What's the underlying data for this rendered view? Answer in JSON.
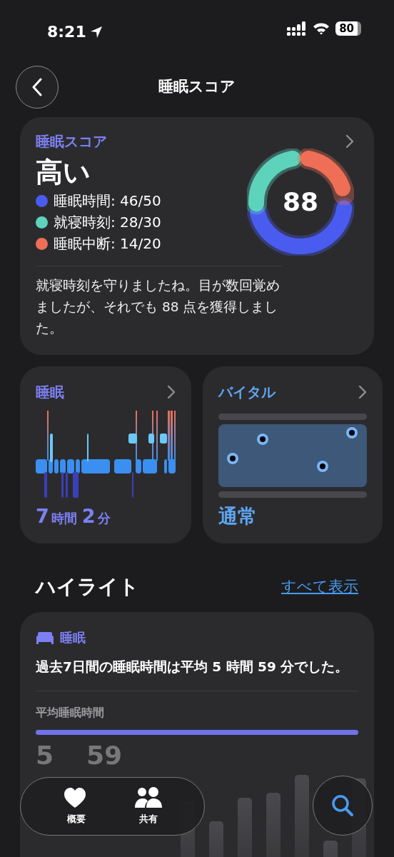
{
  "status_bar": {
    "time": "8:21",
    "battery": "80"
  },
  "header": {
    "title": "睡眠スコア"
  },
  "score_card": {
    "title": "睡眠スコア",
    "rating": "高い",
    "score": "88",
    "items": [
      {
        "label": "睡眠時間: 46/50",
        "color": "#4a5cf0"
      },
      {
        "label": "就寝時刻: 28/30",
        "color": "#5dd3bb"
      },
      {
        "label": "睡眠中断: 14/20",
        "color": "#ee6f56"
      }
    ],
    "summary": "就寝時刻を守りましたね。目が数回覚めましたが、それでも 88 点を獲得しました。"
  },
  "sleep_card": {
    "title": "睡眠",
    "hours": "7",
    "hours_unit": "時間",
    "minutes": "2",
    "minutes_unit": "分"
  },
  "vitals_card": {
    "title": "バイタル",
    "status": "通常"
  },
  "highlights": {
    "title": "ハイライト",
    "see_all": "すべて表示",
    "card": {
      "category": "睡眠",
      "text": "過去7日間の睡眠時間は平均 5 時間 59 分でした。",
      "metric_label": "平均睡眠時間",
      "value_hours": "5",
      "value_minutes": "59"
    }
  },
  "tab_bar": {
    "tabs": [
      {
        "label": "概要",
        "kind": "heart"
      },
      {
        "label": "共有",
        "kind": "people"
      }
    ]
  }
}
